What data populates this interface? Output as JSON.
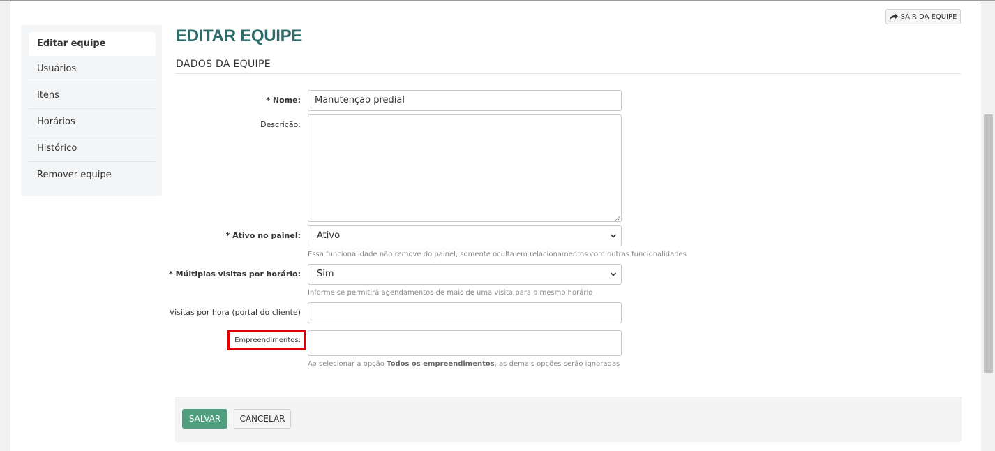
{
  "header": {
    "exit_button": "SAIR DA EQUIPE",
    "title": "EDITAR EQUIPE",
    "section": "DADOS DA EQUIPE"
  },
  "sidebar": {
    "items": [
      {
        "label": "Editar equipe"
      },
      {
        "label": "Usuários"
      },
      {
        "label": "Itens"
      },
      {
        "label": "Horários"
      },
      {
        "label": "Histórico"
      },
      {
        "label": "Remover equipe"
      }
    ]
  },
  "form": {
    "nome": {
      "label": "* Nome:",
      "value": "Manutenção predial"
    },
    "descricao": {
      "label": "Descrição:",
      "value": ""
    },
    "ativo": {
      "label": "* Ativo no painel:",
      "value": "Ativo",
      "help": "Essa funcionalidade não remove do painel, somente oculta em relacionamentos com outras funcionalidades"
    },
    "multiplas": {
      "label": "* Múltiplas visitas por horário:",
      "value": "Sim",
      "help": "Informe se permitirá agendamentos de mais de uma visita para o mesmo horário"
    },
    "visitas_hora": {
      "label": "Visitas por hora (portal do cliente)",
      "value": ""
    },
    "empreendimentos": {
      "label": "Empreendimentos:",
      "value": "",
      "help_prefix": "Ao selecionar a opção ",
      "help_bold": "Todos os empreendimentos",
      "help_suffix": ", as demais opções serão ignoradas"
    }
  },
  "footer": {
    "save": "SALVAR",
    "cancel": "CANCELAR"
  },
  "colors": {
    "title": "#2e6b6b",
    "save_button": "#4f9e7e",
    "highlight": "#e00000"
  }
}
